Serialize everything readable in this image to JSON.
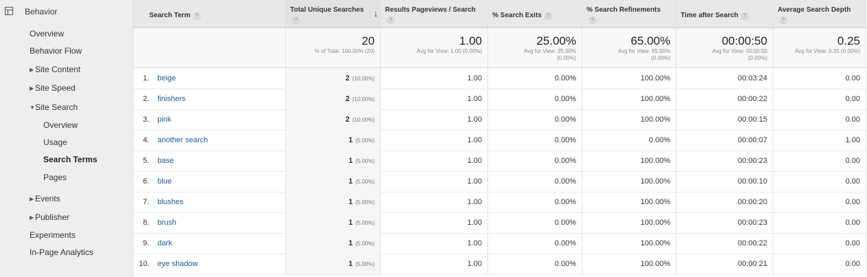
{
  "sidebar": {
    "header": "Behavior",
    "items": [
      {
        "label": "Overview"
      },
      {
        "label": "Behavior Flow"
      },
      {
        "label": "Site Content"
      },
      {
        "label": "Site Speed"
      },
      {
        "label": "Site Search"
      },
      {
        "label": "Overview"
      },
      {
        "label": "Usage"
      },
      {
        "label": "Search Terms"
      },
      {
        "label": "Pages"
      },
      {
        "label": "Events"
      },
      {
        "label": "Publisher"
      },
      {
        "label": "Experiments"
      },
      {
        "label": "In-Page Analytics"
      }
    ]
  },
  "table": {
    "headers": [
      "Search Term",
      "Total Unique Searches",
      "Results Pageviews / Search",
      "% Search Exits",
      "% Search Refinements",
      "Time after Search",
      "Average Search Depth"
    ],
    "help_glyph": "?",
    "sort_arrow": "↓",
    "totals": [
      {
        "value": "20",
        "sub1": "% of Total: 100.00% (20)",
        "sub2": ""
      },
      {
        "value": "1.00",
        "sub1": "Avg for View: 1.00 (0.00%)",
        "sub2": ""
      },
      {
        "value": "25.00%",
        "sub1": "Avg for View: 25.00%",
        "sub2": "(0.00%)"
      },
      {
        "value": "65.00%",
        "sub1": "Avg for View: 65.00%",
        "sub2": "(0.00%)"
      },
      {
        "value": "00:00:50",
        "sub1": "Avg for View: 00:00:50",
        "sub2": "(0.00%)"
      },
      {
        "value": "0.25",
        "sub1": "Avg for View: 0.25 (0.00%)",
        "sub2": ""
      }
    ],
    "rows": [
      {
        "num": "1.",
        "term": "beige",
        "searches": "2",
        "pct": "(10.00%)",
        "rpv": "1.00",
        "exits": "0.00%",
        "ref": "100.00%",
        "time": "00:03:24",
        "depth": "0.00"
      },
      {
        "num": "2.",
        "term": "finishers",
        "searches": "2",
        "pct": "(10.00%)",
        "rpv": "1.00",
        "exits": "0.00%",
        "ref": "100.00%",
        "time": "00:00:22",
        "depth": "0.00"
      },
      {
        "num": "3.",
        "term": "pink",
        "searches": "2",
        "pct": "(10.00%)",
        "rpv": "1.00",
        "exits": "0.00%",
        "ref": "100.00%",
        "time": "00:00:15",
        "depth": "0.00"
      },
      {
        "num": "4.",
        "term": "another search",
        "searches": "1",
        "pct": "(5.00%)",
        "rpv": "1.00",
        "exits": "0.00%",
        "ref": "0.00%",
        "time": "00:00:07",
        "depth": "1.00"
      },
      {
        "num": "5.",
        "term": "base",
        "searches": "1",
        "pct": "(5.00%)",
        "rpv": "1.00",
        "exits": "0.00%",
        "ref": "100.00%",
        "time": "00:00:23",
        "depth": "0.00"
      },
      {
        "num": "6.",
        "term": "blue",
        "searches": "1",
        "pct": "(5.00%)",
        "rpv": "1.00",
        "exits": "0.00%",
        "ref": "100.00%",
        "time": "00:00:10",
        "depth": "0.00"
      },
      {
        "num": "7.",
        "term": "blushes",
        "searches": "1",
        "pct": "(5.00%)",
        "rpv": "1.00",
        "exits": "0.00%",
        "ref": "100.00%",
        "time": "00:00:20",
        "depth": "0.00"
      },
      {
        "num": "8.",
        "term": "brush",
        "searches": "1",
        "pct": "(5.00%)",
        "rpv": "1.00",
        "exits": "0.00%",
        "ref": "100.00%",
        "time": "00:00:23",
        "depth": "0.00"
      },
      {
        "num": "9.",
        "term": "dark",
        "searches": "1",
        "pct": "(5.00%)",
        "rpv": "1.00",
        "exits": "0.00%",
        "ref": "100.00%",
        "time": "00:00:22",
        "depth": "0.00"
      },
      {
        "num": "10.",
        "term": "eye shadow",
        "searches": "1",
        "pct": "(5.00%)",
        "rpv": "1.00",
        "exits": "0.00%",
        "ref": "100.00%",
        "time": "00:00:21",
        "depth": "0.00"
      }
    ]
  }
}
